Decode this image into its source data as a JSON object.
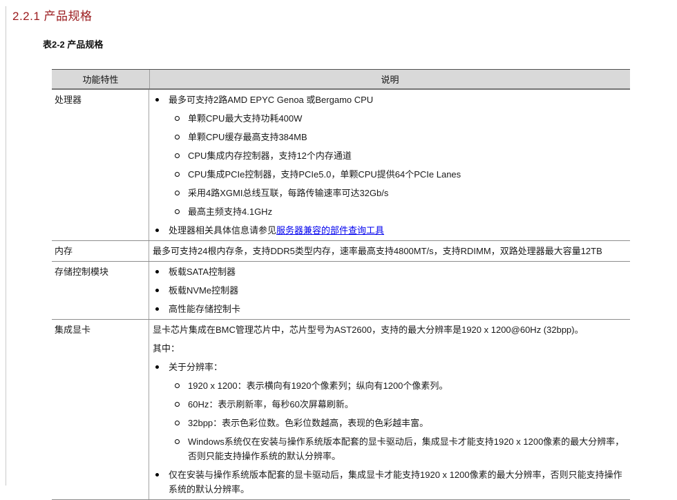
{
  "page": {
    "heading": "2.2.1 产品规格",
    "table_caption": "表2-2 产品规格"
  },
  "colors": {
    "heading_red": "#9a1a1d",
    "link_blue": "#0000ee",
    "table_header_bg": "#d9d9d9",
    "border_gray": "#8c8c8c"
  },
  "table": {
    "headers": [
      "功能特性",
      "说明"
    ],
    "rows": [
      {
        "feature": "处理器",
        "items": [
          {
            "level": 1,
            "text": "最多可支持2路AMD EPYC Genoa 或Bergamo CPU"
          },
          {
            "level": 2,
            "text": "单颗CPU最大支持功耗400W"
          },
          {
            "level": 2,
            "text": "单颗CPU缓存最高支持384MB"
          },
          {
            "level": 2,
            "text": "CPU集成内存控制器，支持12个内存通道"
          },
          {
            "level": 2,
            "text": "CPU集成PCIe控制器，支持PCIe5.0，单颗CPU提供64个PCIe Lanes"
          },
          {
            "level": 2,
            "text": "采用4路XGMI总线互联，每路传输速率可达32Gb/s"
          },
          {
            "level": 2,
            "text": "最高主频支持4.1GHz"
          },
          {
            "level": 1,
            "text": "处理器相关具体信息请参见",
            "link": "服务器兼容的部件查询工具"
          }
        ]
      },
      {
        "feature": "内存",
        "items": [
          {
            "level": 0,
            "text": "最多可支持24根内存条，支持DDR5类型内存，速率最高支持4800MT/s，支持RDIMM，双路处理器最大容量12TB"
          }
        ]
      },
      {
        "feature": "存储控制模块",
        "items": [
          {
            "level": 1,
            "text": "板载SATA控制器"
          },
          {
            "level": 1,
            "text": "板载NVMe控制器"
          },
          {
            "level": 1,
            "text": "高性能存储控制卡"
          }
        ]
      },
      {
        "feature": "集成显卡",
        "items": [
          {
            "level": 0,
            "text": "显卡芯片集成在BMC管理芯片中，芯片型号为AST2600，支持的最大分辨率是1920 x 1200@60Hz (32bpp)。"
          },
          {
            "level": 0,
            "text": "其中："
          },
          {
            "level": 1,
            "text": "关于分辨率："
          },
          {
            "level": 2,
            "text": "1920 x 1200：表示横向有1920个像素列；纵向有1200个像素列。"
          },
          {
            "level": 2,
            "text": "60Hz：表示刷新率，每秒60次屏幕刷新。"
          },
          {
            "level": 2,
            "text": "32bpp：表示色彩位数。色彩位数越高，表现的色彩越丰富。"
          },
          {
            "level": 2,
            "text": "Windows系统仅在安装与操作系统版本配套的显卡驱动后，集成显卡才能支持1920 x 1200像素的最大分辨率，否则只能支持操作系统的默认分辨率。"
          },
          {
            "level": 1,
            "text": "仅在安装与操作系统版本配套的显卡驱动后，集成显卡才能支持1920 x 1200像素的最大分辨率，否则只能支持操作系统的默认分辨率。"
          }
        ]
      }
    ]
  }
}
